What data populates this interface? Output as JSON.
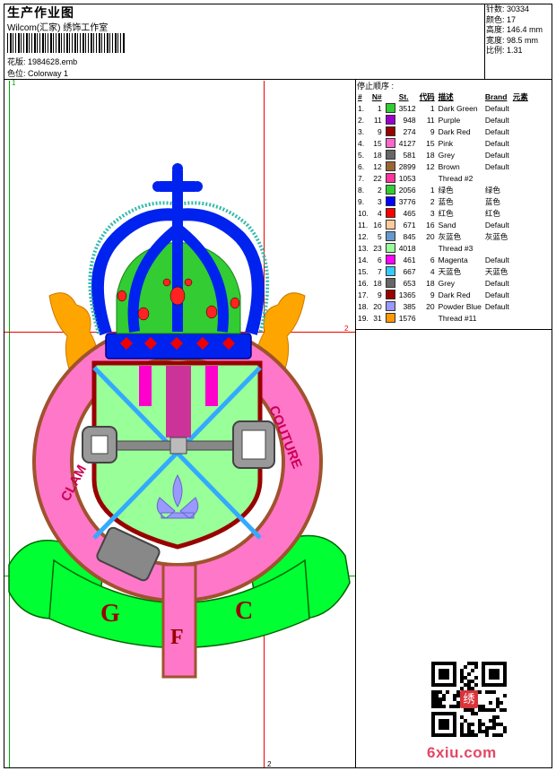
{
  "header": {
    "title": "生产作业图",
    "company": "Wilcom(汇家) 绣饰工作室",
    "design_file_label": "花版:",
    "design_file": "1984628.emb",
    "colorway_label": "色位:",
    "colorway": "Colorway 1"
  },
  "stats": {
    "stitches_label": "针数:",
    "stitches": "30334",
    "colors_label": "颜色:",
    "colors": "17",
    "height_label": "高度:",
    "height": "146.4 mm",
    "width_label": "宽度:",
    "width": "98.5 mm",
    "ratio_label": "比例:",
    "ratio": "1.31"
  },
  "stop_sequence": {
    "title": "停止顺序 :",
    "headers": [
      "#",
      "N#",
      "St.",
      "代码",
      "描述",
      "Brand",
      "元素"
    ],
    "rows": [
      {
        "idx": "1.",
        "n": "1",
        "st": "3512",
        "code": "1",
        "desc": "Dark Green",
        "brand": "Default",
        "color": "#33cc33"
      },
      {
        "idx": "2.",
        "n": "11",
        "st": "948",
        "code": "11",
        "desc": "Purple",
        "brand": "Default",
        "color": "#9900cc"
      },
      {
        "idx": "3.",
        "n": "9",
        "st": "274",
        "code": "9",
        "desc": "Dark Red",
        "brand": "Default",
        "color": "#990000"
      },
      {
        "idx": "4.",
        "n": "15",
        "st": "4127",
        "code": "15",
        "desc": "Pink",
        "brand": "Default",
        "color": "#ff66cc"
      },
      {
        "idx": "5.",
        "n": "18",
        "st": "581",
        "code": "18",
        "desc": "Grey",
        "brand": "Default",
        "color": "#666666"
      },
      {
        "idx": "6.",
        "n": "12",
        "st": "2899",
        "code": "12",
        "desc": "Brown",
        "brand": "Default",
        "color": "#996633"
      },
      {
        "idx": "7.",
        "n": "22",
        "st": "1053",
        "code": "",
        "desc": "Thread #2",
        "brand": "",
        "color": "#ff3399"
      },
      {
        "idx": "8.",
        "n": "2",
        "st": "2056",
        "code": "1",
        "desc": "绿色",
        "brand": "绿色",
        "color": "#33cc33"
      },
      {
        "idx": "9.",
        "n": "3",
        "st": "3776",
        "code": "2",
        "desc": "蓝色",
        "brand": "蓝色",
        "color": "#0000ff"
      },
      {
        "idx": "10.",
        "n": "4",
        "st": "465",
        "code": "3",
        "desc": "红色",
        "brand": "红色",
        "color": "#ff0000"
      },
      {
        "idx": "11.",
        "n": "16",
        "st": "671",
        "code": "16",
        "desc": "Sand",
        "brand": "Default",
        "color": "#ffcc99"
      },
      {
        "idx": "12.",
        "n": "5",
        "st": "845",
        "code": "20",
        "desc": "灰蓝色",
        "brand": "灰蓝色",
        "color": "#6699cc"
      },
      {
        "idx": "13.",
        "n": "23",
        "st": "4018",
        "code": "",
        "desc": "Thread #3",
        "brand": "",
        "color": "#99ff99"
      },
      {
        "idx": "14.",
        "n": "6",
        "st": "461",
        "code": "6",
        "desc": "Magenta",
        "brand": "Default",
        "color": "#ff00ff"
      },
      {
        "idx": "15.",
        "n": "7",
        "st": "667",
        "code": "4",
        "desc": "天蓝色",
        "brand": "天蓝色",
        "color": "#33ccff"
      },
      {
        "idx": "16.",
        "n": "18",
        "st": "653",
        "code": "18",
        "desc": "Grey",
        "brand": "Default",
        "color": "#666666"
      },
      {
        "idx": "17.",
        "n": "9",
        "st": "1365",
        "code": "9",
        "desc": "Dark Red",
        "brand": "Default",
        "color": "#990000"
      },
      {
        "idx": "18.",
        "n": "20",
        "st": "385",
        "code": "20",
        "desc": "Powder Blue",
        "brand": "Default",
        "color": "#9999ff"
      },
      {
        "idx": "19.",
        "n": "31",
        "st": "1576",
        "code": "",
        "desc": "Thread #11",
        "brand": "",
        "color": "#ff9900"
      }
    ]
  },
  "guides": {
    "label_1": "1",
    "label_2_right": "2",
    "label_2_bottom": "2"
  },
  "emblem": {
    "letters_left": "CLAM",
    "letters_right": "COUTURE",
    "initial_left": "G",
    "initial_right": "C",
    "initial_bottom": "F"
  },
  "watermark": {
    "site": "6xiu.com",
    "stamp_text": "绣"
  }
}
